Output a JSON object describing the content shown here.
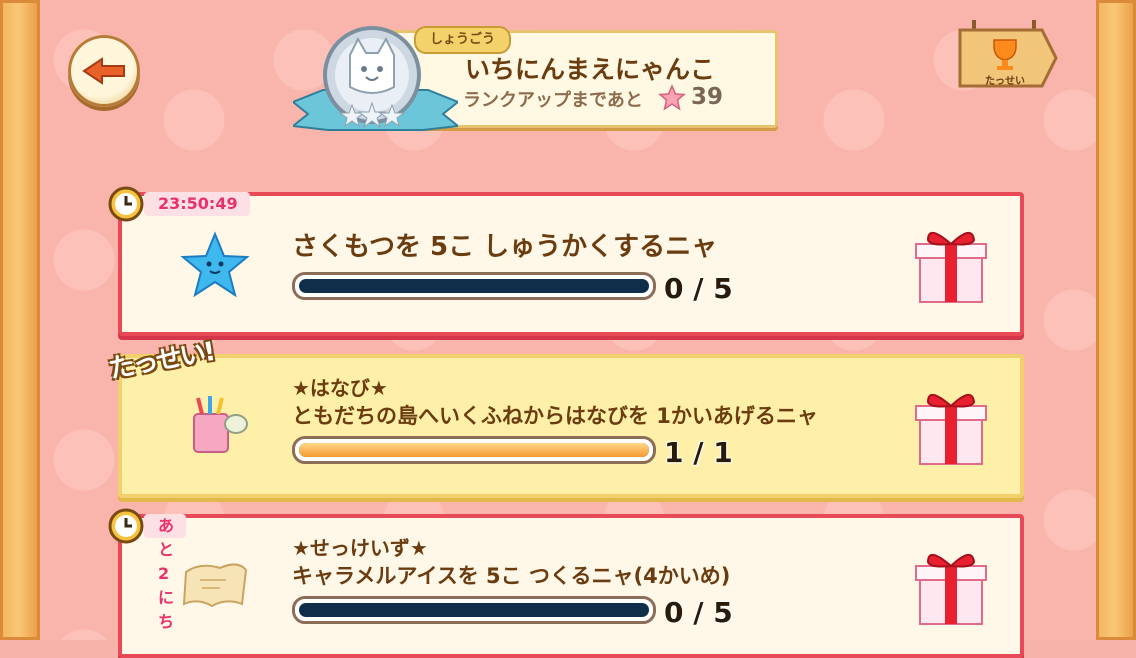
{
  "header": {
    "rank_tag": "しょうごう",
    "rank_title": "いちにんまえにゃんこ",
    "rank_up_label": "ランクアップまであと",
    "rank_up_count": "39",
    "achievements_label": "たっせい"
  },
  "missions": [
    {
      "timer": "23:50:49",
      "title": "さくもつを 5こ しゅうかくするニャ",
      "progress_text": "0 / 5",
      "progress": 0.0,
      "icon": "blue-star-icon",
      "reward_icon": "gift-icon"
    },
    {
      "stamp": "たっせい!",
      "event": "★はなび★",
      "title": "ともだちの島へいくふねからはなびを 1かいあげるニャ",
      "progress_text": "1 / 1",
      "progress": 1.0,
      "icon": "fireworks-bucket-icon",
      "reward_icon": "gift-icon"
    },
    {
      "timer": "あと2にち",
      "event": "★せっけいず★",
      "title": "キャラメルアイスを 5こ つくるニャ(4かいめ)",
      "progress_text": "0 / 5",
      "progress": 0.0,
      "icon": "blueprint-scroll-icon",
      "reward_icon": "gift-icon"
    }
  ],
  "colors": {
    "card_border": "#e84a58",
    "done_card": "#fff0a9",
    "text": "#6b3c10",
    "timer": "#e8316d",
    "bar_empty": "#0e2e4a"
  }
}
